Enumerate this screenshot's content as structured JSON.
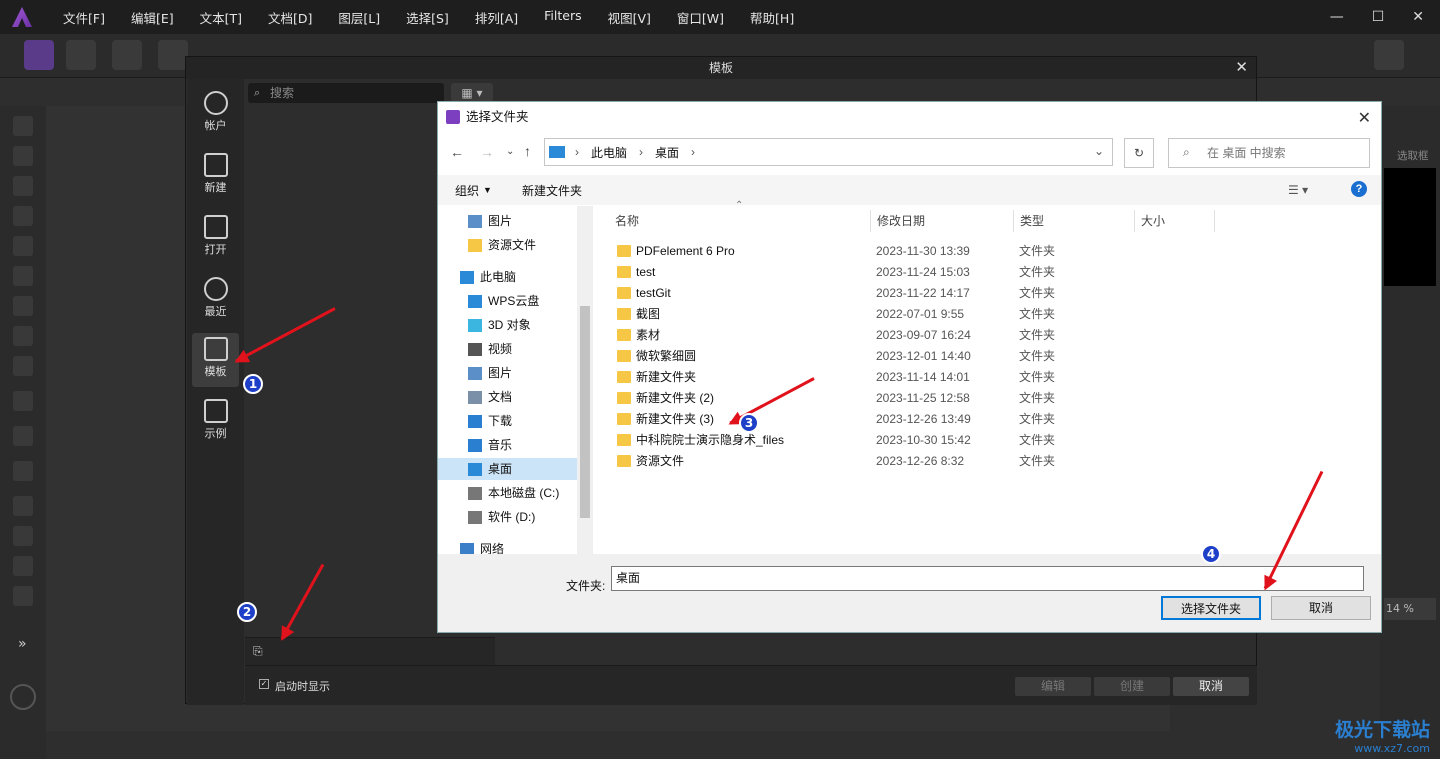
{
  "menubar": {
    "items": [
      "文件[F]",
      "编辑[E]",
      "文本[T]",
      "文档[D]",
      "图层[L]",
      "选择[S]",
      "排列[A]",
      "Filters",
      "视图[V]",
      "窗口[W]",
      "帮助[H]"
    ]
  },
  "template_dialog": {
    "title": "模板",
    "search_placeholder": "搜索",
    "sidebar": [
      "帐户",
      "新建",
      "打开",
      "最近",
      "模板",
      "示例"
    ],
    "selected": "模板",
    "show_on_startup": "启动时显示",
    "buttons": {
      "edit": "编辑",
      "create": "创建",
      "cancel": "取消"
    }
  },
  "right_panel": {
    "select_box": "选取框",
    "zoom": "14 %"
  },
  "folder_dialog": {
    "title": "选择文件夹",
    "breadcrumb": [
      "此电脑",
      "桌面"
    ],
    "search_placeholder": "在 桌面 中搜索",
    "organize": "组织",
    "new_folder": "新建文件夹",
    "nav": [
      {
        "label": "图片",
        "icon": "pictures-icon",
        "indent": 1
      },
      {
        "label": "资源文件",
        "icon": "folder-icon",
        "indent": 1
      },
      {
        "label": "此电脑",
        "icon": "computer-icon",
        "indent": 0
      },
      {
        "label": "WPS云盘",
        "icon": "cloud-icon",
        "indent": 1
      },
      {
        "label": "3D 对象",
        "icon": "3d-objects-icon",
        "indent": 1
      },
      {
        "label": "视频",
        "icon": "video-icon",
        "indent": 1
      },
      {
        "label": "图片",
        "icon": "pictures-icon",
        "indent": 1
      },
      {
        "label": "文档",
        "icon": "documents-icon",
        "indent": 1
      },
      {
        "label": "下载",
        "icon": "download-icon",
        "indent": 1
      },
      {
        "label": "音乐",
        "icon": "music-icon",
        "indent": 1
      },
      {
        "label": "桌面",
        "icon": "desktop-icon",
        "indent": 1,
        "selected": true
      },
      {
        "label": "本地磁盘 (C:)",
        "icon": "drive-icon",
        "indent": 1
      },
      {
        "label": "软件 (D:)",
        "icon": "drive-icon",
        "indent": 1
      },
      {
        "label": "网络",
        "icon": "network-icon",
        "indent": 0
      }
    ],
    "columns": [
      "名称",
      "修改日期",
      "类型",
      "大小"
    ],
    "files": [
      {
        "name": "PDFelement 6 Pro",
        "date": "2023-11-30 13:39",
        "type": "文件夹"
      },
      {
        "name": "test",
        "date": "2023-11-24 15:03",
        "type": "文件夹"
      },
      {
        "name": "testGit",
        "date": "2023-11-22 14:17",
        "type": "文件夹"
      },
      {
        "name": "截图",
        "date": "2022-07-01 9:55",
        "type": "文件夹"
      },
      {
        "name": "素材",
        "date": "2023-09-07 16:24",
        "type": "文件夹"
      },
      {
        "name": "微软繁细圆",
        "date": "2023-12-01 14:40",
        "type": "文件夹"
      },
      {
        "name": "新建文件夹",
        "date": "2023-11-14 14:01",
        "type": "文件夹"
      },
      {
        "name": "新建文件夹 (2)",
        "date": "2023-11-25 12:58",
        "type": "文件夹"
      },
      {
        "name": "新建文件夹 (3)",
        "date": "2023-12-26 13:49",
        "type": "文件夹"
      },
      {
        "name": "中科院院士演示隐身术_files",
        "date": "2023-10-30 15:42",
        "type": "文件夹"
      },
      {
        "name": "资源文件",
        "date": "2023-12-26 8:32",
        "type": "文件夹"
      }
    ],
    "folder_label": "文件夹:",
    "folder_value": "桌面",
    "select_button": "选择文件夹",
    "cancel_button": "取消"
  },
  "annotations": [
    "1",
    "2",
    "3",
    "4"
  ],
  "watermark": {
    "name": "极光下载站",
    "url": "www.xz7.com"
  },
  "colors": {
    "accent": "#0078d7",
    "arrow": "#e0121b",
    "badge": "#1e40c8",
    "folder": "#f6c744"
  }
}
